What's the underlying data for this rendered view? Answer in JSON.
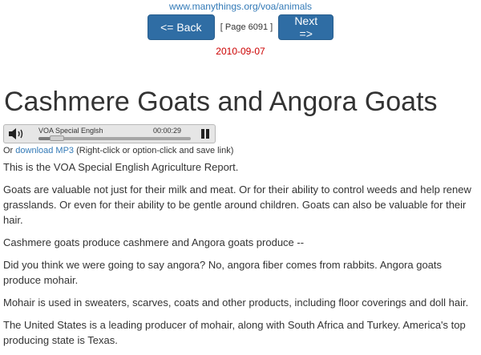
{
  "header": {
    "site_link": "www.manythings.org/voa/animals",
    "back_label": "<= Back",
    "page_indicator": "[ Page 6091 ]",
    "next_label": "Next =>",
    "date": "2010-09-07"
  },
  "article": {
    "title": "Cashmere Goats and Angora Goats",
    "paragraphs": [
      "This is the VOA Special English Agriculture Report.",
      "Goats are valuable not just for their milk and meat. Or for their ability to control weeds and help renew grasslands. Or even for their ability to be gentle around children. Goats can also be valuable for their hair.",
      "Cashmere goats produce cashmere and Angora goats produce --",
      "Did you think we were going to say angora? No, angora fiber comes from rabbits. Angora goats produce mohair.",
      "Mohair is used in sweaters, scarves, coats and other products, including floor coverings and doll hair.",
      "The United States is a leading producer of mohair, along with South Africa and Turkey. America's top producing state is Texas."
    ]
  },
  "player": {
    "track_title": "VOA Special Englsh",
    "time": "00:00:29",
    "progress_fraction": 0.12,
    "speaker_icon": "speaker-icon",
    "pause_icon": "pause-icon"
  },
  "download": {
    "prefix": "Or ",
    "link_text": "download MP3",
    "suffix": " (Right-click or option-click and save link)"
  },
  "colors": {
    "link": "#337ab7",
    "button": "#2f6da4",
    "date": "#cc0000",
    "text": "#333333"
  }
}
